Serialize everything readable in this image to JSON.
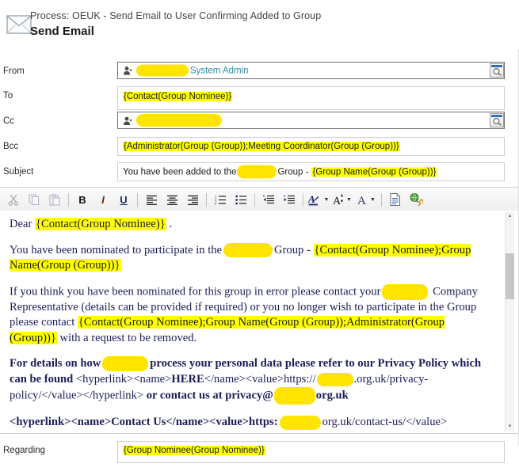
{
  "header": {
    "icon": "email-envelope-icon",
    "process_label": "Process: OEUK - Send Email to User Confirming Added to Group",
    "title": "Send Email"
  },
  "fields": {
    "from": {
      "label": "From",
      "icon": "contact-person-icon",
      "value": "System Admin",
      "redacted": true,
      "lookup_icon": "lookup-search-icon"
    },
    "to": {
      "label": "To",
      "value": "{Contact(Group Nominee)}",
      "highlighted": true
    },
    "cc": {
      "label": "Cc",
      "icon": "contact-person-icon",
      "value": "",
      "redacted": true,
      "lookup_icon": "lookup-search-icon"
    },
    "bcc": {
      "label": "Bcc",
      "value": "{Administrator(Group (Group));Meeting Coordinator(Group (Group))}",
      "highlighted": true
    },
    "subject": {
      "label": "Subject",
      "value_prefix": "You have been added to the",
      "value_mid": "Group -",
      "value_token": "{Group Name(Group (Group))}",
      "redacted": true
    },
    "regarding": {
      "label": "Regarding",
      "value": "{Group Nominee(Group Nominee)}",
      "highlighted": true
    }
  },
  "toolbar": {
    "buttons": [
      {
        "name": "cut-icon",
        "label": "✂",
        "kind": "icon"
      },
      {
        "name": "copy-icon",
        "label": "❐",
        "kind": "icon"
      },
      {
        "name": "paste-icon",
        "label": "ὌB",
        "kind": "icon"
      },
      {
        "name": "bold-button",
        "label": "B",
        "kind": "text"
      },
      {
        "name": "italic-button",
        "label": "I",
        "kind": "text"
      },
      {
        "name": "underline-button",
        "label": "U",
        "kind": "text"
      },
      {
        "name": "align-left-icon",
        "label": "",
        "kind": "icon"
      },
      {
        "name": "align-center-icon",
        "label": "",
        "kind": "icon"
      },
      {
        "name": "align-right-icon",
        "label": "",
        "kind": "icon"
      },
      {
        "name": "numbered-list-icon",
        "label": "",
        "kind": "icon"
      },
      {
        "name": "bulleted-list-icon",
        "label": "",
        "kind": "icon"
      },
      {
        "name": "decrease-indent-icon",
        "label": "",
        "kind": "icon"
      },
      {
        "name": "increase-indent-icon",
        "label": "",
        "kind": "icon"
      },
      {
        "name": "font-color-icon",
        "label": "A",
        "kind": "icon"
      },
      {
        "name": "font-size-icon",
        "label": "A",
        "kind": "icon"
      },
      {
        "name": "font-face-icon",
        "label": "A",
        "kind": "icon"
      },
      {
        "name": "insert-template-icon",
        "label": "",
        "kind": "icon"
      },
      {
        "name": "insert-hyperlink-icon",
        "label": "",
        "kind": "icon"
      }
    ]
  },
  "body": {
    "p1_pre": "Dear ",
    "p1_token": "{Contact(Group Nominee)}",
    "p1_post": " .",
    "p2_pre": "You have been nominated to participate in the",
    "p2_mid": "Group -",
    "p2_token": "{Contact(Group Nominee);Group Name(Group (Group))}",
    "p3_pre": "If you think you have been nominated for this group in error please contact your",
    "p3_mid": "Company Representative (details can be provided if required) or you no longer wish to participate in the Group please contact ",
    "p3_token": "{Contact(Group Nominee);Group Name(Group (Group));Administrator(Group (Group))}",
    "p3_post": " with a request to be removed.",
    "p4_pre": "For details on how",
    "p4_mid": "process your personal data please refer to our Privacy Policy which can be found ",
    "p4_tag1": "<hyperlink><name>",
    "p4_here": "HERE",
    "p4_tag2": "</name><value>https://",
    "p4_tag3": ".org.uk/privacy-policy/</value></hyperlink>",
    "p4_post": " or contact us at privacy@",
    "p4_end": "org.uk",
    "p5_pre": "<hyperlink><name>Contact Us</name><value>https:",
    "p5_post": "org.uk/contact-us/</value>"
  },
  "scrollbar": {
    "up_arrow": "▲",
    "down_arrow": "▼"
  },
  "colors": {
    "highlight": "#ffff00",
    "redaction": "#ffe400",
    "body_text": "#1c1c5a",
    "person_link": "#2c8c9e"
  }
}
